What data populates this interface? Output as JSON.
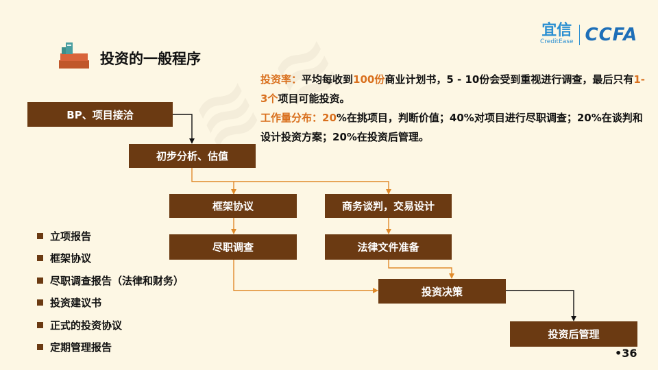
{
  "logo": {
    "brand_cn": "宜信",
    "brand_en": "CreditEase",
    "ccfa": "CCFA"
  },
  "title": "投资的一般程序",
  "info": {
    "rate_label": "投资率：",
    "rate_text_1": "平均每收到",
    "rate_hl_1": "100份",
    "rate_text_2": "商业计划书，5 - 10份会受到重视进行调查，最后只有",
    "rate_hl_2": "1-3个",
    "rate_text_3": "项目可能投资。",
    "work_label": "工作量分布：",
    "work_hl": "20",
    "work_text": "%在挑项目，判断价值；40%对项目进行尽职调查；20%在谈判和设计投资方案；20%在投资后管理。"
  },
  "flow": {
    "bp": "BP、项目接洽",
    "analysis": "初步分析、估值",
    "framework": "框架协议",
    "negotiation": "商务谈判，交易设计",
    "due_diligence": "尽职调查",
    "legal": "法律文件准备",
    "decision": "投资决策",
    "post": "投资后管理"
  },
  "bullets": [
    "立项报告",
    "框架协议",
    "尽职调查报告（法律和财务）",
    "投资建议书",
    "正式的投资协议",
    "定期管理报告"
  ],
  "page_number": "•36",
  "colors": {
    "box": "#6b3a12",
    "arrow_orange": "#e08a2a",
    "arrow_dark": "#111111",
    "highlight": "#d9701e",
    "background": "#fdf7e4"
  }
}
